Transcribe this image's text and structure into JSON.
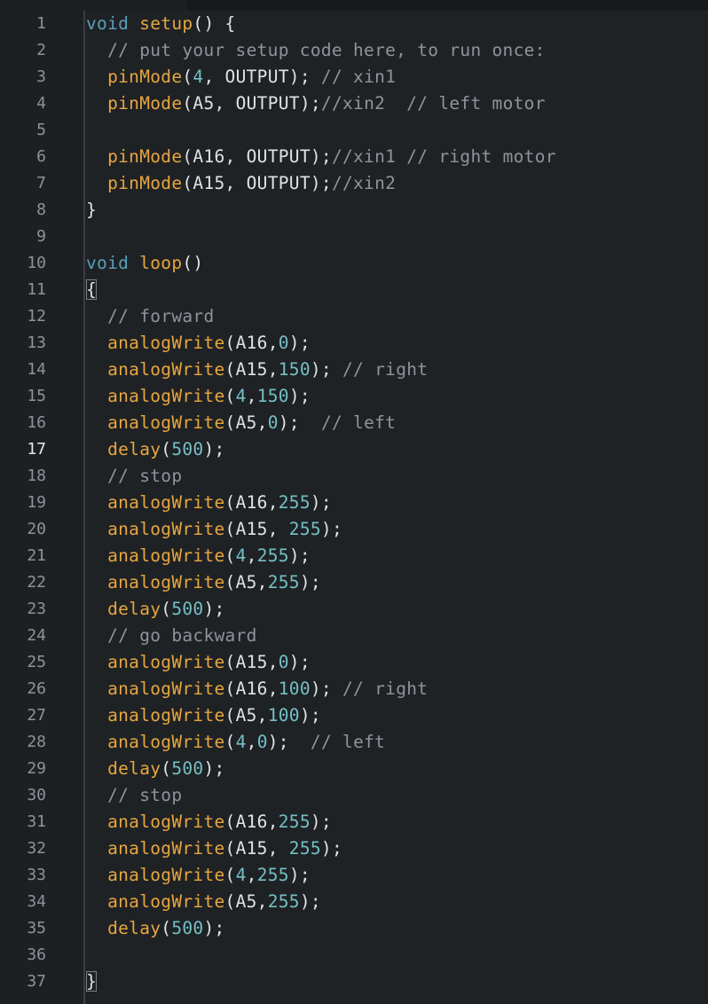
{
  "editor": {
    "active_line": 17,
    "colors": {
      "background": "#1f2225",
      "keyword": "#5aa0bc",
      "function": "#e7a63f",
      "number": "#74c0c5",
      "comment": "#8e949b",
      "text": "#dfe3e7"
    },
    "lines": [
      {
        "n": "1",
        "tokens": [
          {
            "t": "void",
            "c": "kw"
          },
          {
            "t": " ",
            "c": "txt"
          },
          {
            "t": "setup",
            "c": "fn"
          },
          {
            "t": "() {",
            "c": "txt"
          }
        ]
      },
      {
        "n": "2",
        "tokens": [
          {
            "t": "  // put your setup code here, to run once:",
            "c": "cmt"
          }
        ]
      },
      {
        "n": "3",
        "tokens": [
          {
            "t": "  ",
            "c": "txt"
          },
          {
            "t": "pinMode",
            "c": "fn"
          },
          {
            "t": "(",
            "c": "txt"
          },
          {
            "t": "4",
            "c": "num"
          },
          {
            "t": ", OUTPUT); ",
            "c": "txt"
          },
          {
            "t": "// xin1",
            "c": "cmt"
          }
        ]
      },
      {
        "n": "4",
        "tokens": [
          {
            "t": "  ",
            "c": "txt"
          },
          {
            "t": "pinMode",
            "c": "fn"
          },
          {
            "t": "(A5, OUTPUT);",
            "c": "txt"
          },
          {
            "t": "//xin2  // left motor",
            "c": "cmt"
          }
        ]
      },
      {
        "n": "5",
        "tokens": []
      },
      {
        "n": "6",
        "tokens": [
          {
            "t": "  ",
            "c": "txt"
          },
          {
            "t": "pinMode",
            "c": "fn"
          },
          {
            "t": "(A16, OUTPUT);",
            "c": "txt"
          },
          {
            "t": "//xin1 // right motor",
            "c": "cmt"
          }
        ]
      },
      {
        "n": "7",
        "tokens": [
          {
            "t": "  ",
            "c": "txt"
          },
          {
            "t": "pinMode",
            "c": "fn"
          },
          {
            "t": "(A15, OUTPUT);",
            "c": "txt"
          },
          {
            "t": "//xin2",
            "c": "cmt"
          }
        ]
      },
      {
        "n": "8",
        "tokens": [
          {
            "t": "}",
            "c": "txt"
          }
        ]
      },
      {
        "n": "9",
        "tokens": []
      },
      {
        "n": "10",
        "tokens": [
          {
            "t": "void",
            "c": "kw"
          },
          {
            "t": " ",
            "c": "txt"
          },
          {
            "t": "loop",
            "c": "fn"
          },
          {
            "t": "()",
            "c": "txt"
          }
        ]
      },
      {
        "n": "11",
        "tokens": [
          {
            "t": "{",
            "c": "brace-hl"
          }
        ]
      },
      {
        "n": "12",
        "tokens": [
          {
            "t": "  // forward",
            "c": "cmt"
          }
        ]
      },
      {
        "n": "13",
        "tokens": [
          {
            "t": "  ",
            "c": "txt"
          },
          {
            "t": "analogWrite",
            "c": "fn"
          },
          {
            "t": "(A16,",
            "c": "txt"
          },
          {
            "t": "0",
            "c": "num"
          },
          {
            "t": ");",
            "c": "txt"
          }
        ]
      },
      {
        "n": "14",
        "tokens": [
          {
            "t": "  ",
            "c": "txt"
          },
          {
            "t": "analogWrite",
            "c": "fn"
          },
          {
            "t": "(A15,",
            "c": "txt"
          },
          {
            "t": "150",
            "c": "num"
          },
          {
            "t": "); ",
            "c": "txt"
          },
          {
            "t": "// right",
            "c": "cmt"
          }
        ]
      },
      {
        "n": "15",
        "tokens": [
          {
            "t": "  ",
            "c": "txt"
          },
          {
            "t": "analogWrite",
            "c": "fn"
          },
          {
            "t": "(",
            "c": "txt"
          },
          {
            "t": "4",
            "c": "num"
          },
          {
            "t": ",",
            "c": "txt"
          },
          {
            "t": "150",
            "c": "num"
          },
          {
            "t": ");",
            "c": "txt"
          }
        ]
      },
      {
        "n": "16",
        "tokens": [
          {
            "t": "  ",
            "c": "txt"
          },
          {
            "t": "analogWrite",
            "c": "fn"
          },
          {
            "t": "(A5,",
            "c": "txt"
          },
          {
            "t": "0",
            "c": "num"
          },
          {
            "t": ");  ",
            "c": "txt"
          },
          {
            "t": "// left",
            "c": "cmt"
          }
        ]
      },
      {
        "n": "17",
        "tokens": [
          {
            "t": "  ",
            "c": "txt"
          },
          {
            "t": "delay",
            "c": "fn"
          },
          {
            "t": "(",
            "c": "txt"
          },
          {
            "t": "500",
            "c": "num"
          },
          {
            "t": ");",
            "c": "txt"
          }
        ]
      },
      {
        "n": "18",
        "tokens": [
          {
            "t": "  // stop",
            "c": "cmt"
          }
        ]
      },
      {
        "n": "19",
        "tokens": [
          {
            "t": "  ",
            "c": "txt"
          },
          {
            "t": "analogWrite",
            "c": "fn"
          },
          {
            "t": "(A16,",
            "c": "txt"
          },
          {
            "t": "255",
            "c": "num"
          },
          {
            "t": ");",
            "c": "txt"
          }
        ]
      },
      {
        "n": "20",
        "tokens": [
          {
            "t": "  ",
            "c": "txt"
          },
          {
            "t": "analogWrite",
            "c": "fn"
          },
          {
            "t": "(A15, ",
            "c": "txt"
          },
          {
            "t": "255",
            "c": "num"
          },
          {
            "t": ");",
            "c": "txt"
          }
        ]
      },
      {
        "n": "21",
        "tokens": [
          {
            "t": "  ",
            "c": "txt"
          },
          {
            "t": "analogWrite",
            "c": "fn"
          },
          {
            "t": "(",
            "c": "txt"
          },
          {
            "t": "4",
            "c": "num"
          },
          {
            "t": ",",
            "c": "txt"
          },
          {
            "t": "255",
            "c": "num"
          },
          {
            "t": ");",
            "c": "txt"
          }
        ]
      },
      {
        "n": "22",
        "tokens": [
          {
            "t": "  ",
            "c": "txt"
          },
          {
            "t": "analogWrite",
            "c": "fn"
          },
          {
            "t": "(A5,",
            "c": "txt"
          },
          {
            "t": "255",
            "c": "num"
          },
          {
            "t": ");",
            "c": "txt"
          }
        ]
      },
      {
        "n": "23",
        "tokens": [
          {
            "t": "  ",
            "c": "txt"
          },
          {
            "t": "delay",
            "c": "fn"
          },
          {
            "t": "(",
            "c": "txt"
          },
          {
            "t": "500",
            "c": "num"
          },
          {
            "t": ");",
            "c": "txt"
          }
        ]
      },
      {
        "n": "24",
        "tokens": [
          {
            "t": "  // go backward",
            "c": "cmt"
          }
        ]
      },
      {
        "n": "25",
        "tokens": [
          {
            "t": "  ",
            "c": "txt"
          },
          {
            "t": "analogWrite",
            "c": "fn"
          },
          {
            "t": "(A15,",
            "c": "txt"
          },
          {
            "t": "0",
            "c": "num"
          },
          {
            "t": ");",
            "c": "txt"
          }
        ]
      },
      {
        "n": "26",
        "tokens": [
          {
            "t": "  ",
            "c": "txt"
          },
          {
            "t": "analogWrite",
            "c": "fn"
          },
          {
            "t": "(A16,",
            "c": "txt"
          },
          {
            "t": "100",
            "c": "num"
          },
          {
            "t": "); ",
            "c": "txt"
          },
          {
            "t": "// right",
            "c": "cmt"
          }
        ]
      },
      {
        "n": "27",
        "tokens": [
          {
            "t": "  ",
            "c": "txt"
          },
          {
            "t": "analogWrite",
            "c": "fn"
          },
          {
            "t": "(A5,",
            "c": "txt"
          },
          {
            "t": "100",
            "c": "num"
          },
          {
            "t": ");",
            "c": "txt"
          }
        ]
      },
      {
        "n": "28",
        "tokens": [
          {
            "t": "  ",
            "c": "txt"
          },
          {
            "t": "analogWrite",
            "c": "fn"
          },
          {
            "t": "(",
            "c": "txt"
          },
          {
            "t": "4",
            "c": "num"
          },
          {
            "t": ",",
            "c": "txt"
          },
          {
            "t": "0",
            "c": "num"
          },
          {
            "t": ");  ",
            "c": "txt"
          },
          {
            "t": "// left",
            "c": "cmt"
          }
        ]
      },
      {
        "n": "29",
        "tokens": [
          {
            "t": "  ",
            "c": "txt"
          },
          {
            "t": "delay",
            "c": "fn"
          },
          {
            "t": "(",
            "c": "txt"
          },
          {
            "t": "500",
            "c": "num"
          },
          {
            "t": ");",
            "c": "txt"
          }
        ]
      },
      {
        "n": "30",
        "tokens": [
          {
            "t": "  // stop",
            "c": "cmt"
          }
        ]
      },
      {
        "n": "31",
        "tokens": [
          {
            "t": "  ",
            "c": "txt"
          },
          {
            "t": "analogWrite",
            "c": "fn"
          },
          {
            "t": "(A16,",
            "c": "txt"
          },
          {
            "t": "255",
            "c": "num"
          },
          {
            "t": ");",
            "c": "txt"
          }
        ]
      },
      {
        "n": "32",
        "tokens": [
          {
            "t": "  ",
            "c": "txt"
          },
          {
            "t": "analogWrite",
            "c": "fn"
          },
          {
            "t": "(A15, ",
            "c": "txt"
          },
          {
            "t": "255",
            "c": "num"
          },
          {
            "t": ");",
            "c": "txt"
          }
        ]
      },
      {
        "n": "33",
        "tokens": [
          {
            "t": "  ",
            "c": "txt"
          },
          {
            "t": "analogWrite",
            "c": "fn"
          },
          {
            "t": "(",
            "c": "txt"
          },
          {
            "t": "4",
            "c": "num"
          },
          {
            "t": ",",
            "c": "txt"
          },
          {
            "t": "255",
            "c": "num"
          },
          {
            "t": ");",
            "c": "txt"
          }
        ]
      },
      {
        "n": "34",
        "tokens": [
          {
            "t": "  ",
            "c": "txt"
          },
          {
            "t": "analogWrite",
            "c": "fn"
          },
          {
            "t": "(A5,",
            "c": "txt"
          },
          {
            "t": "255",
            "c": "num"
          },
          {
            "t": ");",
            "c": "txt"
          }
        ]
      },
      {
        "n": "35",
        "tokens": [
          {
            "t": "  ",
            "c": "txt"
          },
          {
            "t": "delay",
            "c": "fn"
          },
          {
            "t": "(",
            "c": "txt"
          },
          {
            "t": "500",
            "c": "num"
          },
          {
            "t": ");",
            "c": "txt"
          }
        ]
      },
      {
        "n": "36",
        "tokens": []
      },
      {
        "n": "37",
        "tokens": [
          {
            "t": "}",
            "c": "brace-hl"
          }
        ]
      }
    ]
  }
}
